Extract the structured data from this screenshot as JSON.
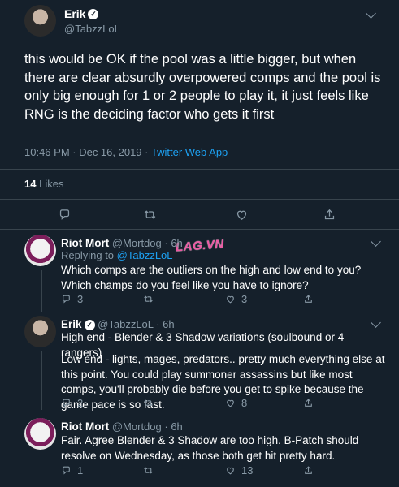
{
  "main_tweet": {
    "author_name": "Erik",
    "handle": "@TabzzLoL",
    "text": "this would be OK if the pool was a little bigger, but when there are clear absurdly overpowered comps and the pool is only big enough for 1 or 2 people to play it, it just feels like RNG is the deciding factor who gets it first",
    "time": "10:46 PM · Dec 16, 2019 ·",
    "source": "Twitter Web App",
    "likes_count": "14",
    "likes_label": "Likes"
  },
  "watermark": {
    "text": "LAG.VN"
  },
  "replies": [
    {
      "author_name": "Riot Mort",
      "handle": "@Mortdog",
      "time": "· 6h",
      "replying_to_label": "Replying to",
      "replying_to_handle": "@TabzzLoL",
      "text": "Which comps are the outliers on the high and low end to you? Which champs do you feel like you have to ignore?",
      "reply_count": "3",
      "retweet_count": "",
      "like_count": "3"
    },
    {
      "author_name": "Erik",
      "handle": "@TabzzLoL",
      "time": "· 6h",
      "text_1": "High end -  Blender & 3 Shadow variations (soulbound or 4 rangers)",
      "text_2": "Low end - lights, mages, predators.. pretty much everything else at this point. You could play summoner assassins but like most comps, you'll probably die before you get to spike because the game pace is so fast.",
      "reply_count": "2",
      "retweet_count": "",
      "like_count": "8"
    },
    {
      "author_name": "Riot Mort",
      "handle": "@Mortdog",
      "time": "· 6h",
      "text": "Fair. Agree Blender & 3 Shadow are too high. B-Patch should resolve on Wednesday, as those both get hit pretty hard.",
      "reply_count": "1",
      "retweet_count": "",
      "like_count": "13"
    }
  ]
}
